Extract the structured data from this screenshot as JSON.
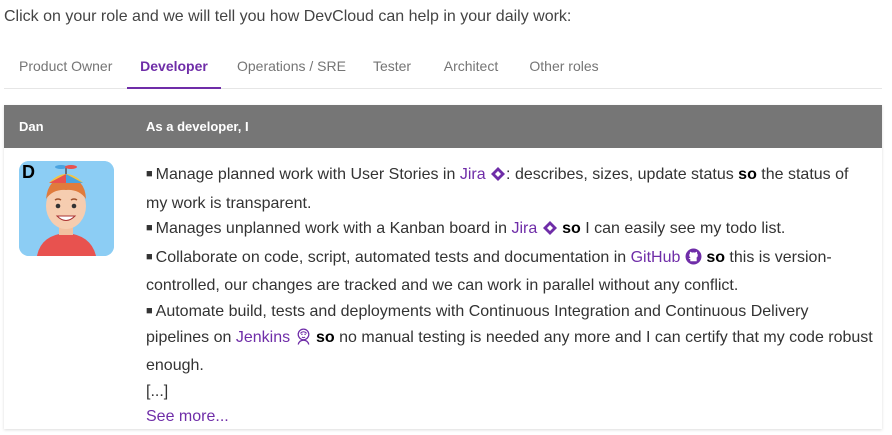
{
  "intro": "Click on your role and we will tell you how DevCloud can help in your daily work:",
  "tabs": [
    {
      "label": "Product Owner"
    },
    {
      "label": "Developer"
    },
    {
      "label": "Operations / SRE"
    },
    {
      "label": "Tester"
    },
    {
      "label": "Architect"
    },
    {
      "label": "Other roles"
    }
  ],
  "active_tab": "Developer",
  "card": {
    "name": "Dan",
    "header": "As a developer, I",
    "avatar_letter": "D",
    "bullets": [
      {
        "t1": "Manage planned work with User Stories in ",
        "link": "Jira",
        "icon": "jira-icon",
        "t2": ": describes, sizes, update status ",
        "so": "so",
        "t3": " the status of my work is transparent."
      },
      {
        "t1": "Manages unplanned work with a Kanban board in ",
        "link": "Jira",
        "icon": "jira-icon",
        "t2": " ",
        "so": "so",
        "t3": " I can easily see my todo list."
      },
      {
        "t1": "Collaborate on code, script, automated tests and documentation in ",
        "link": "GitHub",
        "icon": "github-icon",
        "t2": " ",
        "so": "so",
        "t3": " this is version-controlled, our changes are tracked and we can work in parallel without any conflict."
      },
      {
        "t1": "Automate build, tests and deployments with Continuous Integration and Continuous Delivery pipelines on ",
        "link": "Jenkins",
        "icon": "jenkins-icon",
        "t2": " ",
        "so": "so",
        "t3": " no manual testing is needed any more and I can certify that my code robust enough."
      }
    ],
    "ellipsis": "[...]",
    "see_more": "See more..."
  },
  "colors": {
    "accent": "#6f2da8",
    "header_bg": "#767676",
    "avatar_bg": "#8ccdf4"
  }
}
